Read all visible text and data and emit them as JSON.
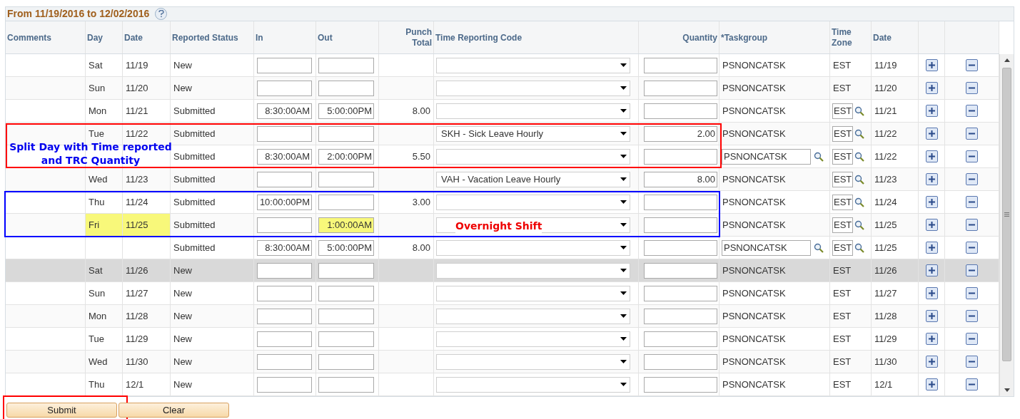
{
  "title": "From 11/19/2016 to 12/02/2016",
  "columns": [
    "Comments",
    "Day",
    "Date",
    "Reported Status",
    "In",
    "Out",
    "Punch Total",
    "Time Reporting Code",
    "Quantity",
    "*Taskgroup",
    "Time Zone",
    "Date"
  ],
  "rows": [
    {
      "day": "Sat",
      "date": "11/19",
      "status": "New",
      "in": "",
      "out": "",
      "punch_total": "",
      "trc": "",
      "quantity": "",
      "taskgroup": "PSNONCATSK",
      "taskgroup_editable": false,
      "timezone": "EST",
      "timezone_editable": false,
      "date2": "11/19",
      "day_highlighted": false,
      "out_highlighted": false,
      "selected": false
    },
    {
      "day": "Sun",
      "date": "11/20",
      "status": "New",
      "in": "",
      "out": "",
      "punch_total": "",
      "trc": "",
      "quantity": "",
      "taskgroup": "PSNONCATSK",
      "taskgroup_editable": false,
      "timezone": "EST",
      "timezone_editable": false,
      "date2": "11/20",
      "day_highlighted": false,
      "out_highlighted": false,
      "selected": false
    },
    {
      "day": "Mon",
      "date": "11/21",
      "status": "Submitted",
      "in": "8:30:00AM",
      "out": "5:00:00PM",
      "punch_total": "8.00",
      "trc": "",
      "quantity": "",
      "taskgroup": "PSNONCATSK",
      "taskgroup_editable": false,
      "timezone": "EST",
      "timezone_editable": true,
      "date2": "11/21",
      "day_highlighted": false,
      "out_highlighted": false,
      "selected": false
    },
    {
      "day": "Tue",
      "date": "11/22",
      "status": "Submitted",
      "in": "",
      "out": "",
      "punch_total": "",
      "trc": "SKH - Sick Leave Hourly",
      "quantity": "2.00",
      "taskgroup": "PSNONCATSK",
      "taskgroup_editable": false,
      "timezone": "EST",
      "timezone_editable": true,
      "date2": "11/22",
      "day_highlighted": false,
      "out_highlighted": false,
      "selected": false
    },
    {
      "day": "",
      "date": "",
      "status": "Submitted",
      "in": "8:30:00AM",
      "out": "2:00:00PM",
      "punch_total": "5.50",
      "trc": "",
      "quantity": "",
      "taskgroup": "PSNONCATSK",
      "taskgroup_editable": true,
      "timezone": "EST",
      "timezone_editable": true,
      "date2": "11/22",
      "day_highlighted": false,
      "out_highlighted": false,
      "selected": false
    },
    {
      "day": "Wed",
      "date": "11/23",
      "status": "Submitted",
      "in": "",
      "out": "",
      "punch_total": "",
      "trc": "VAH - Vacation Leave Hourly",
      "quantity": "8.00",
      "taskgroup": "PSNONCATSK",
      "taskgroup_editable": false,
      "timezone": "EST",
      "timezone_editable": true,
      "date2": "11/23",
      "day_highlighted": false,
      "out_highlighted": false,
      "selected": false
    },
    {
      "day": "Thu",
      "date": "11/24",
      "status": "Submitted",
      "in": "10:00:00PM",
      "out": "",
      "punch_total": "3.00",
      "trc": "",
      "quantity": "",
      "taskgroup": "PSNONCATSK",
      "taskgroup_editable": false,
      "timezone": "EST",
      "timezone_editable": true,
      "date2": "11/24",
      "day_highlighted": false,
      "out_highlighted": false,
      "selected": false
    },
    {
      "day": "Fri",
      "date": "11/25",
      "status": "Submitted",
      "in": "",
      "out": "1:00:00AM",
      "punch_total": "",
      "trc": "",
      "quantity": "",
      "taskgroup": "PSNONCATSK",
      "taskgroup_editable": false,
      "timezone": "EST",
      "timezone_editable": true,
      "date2": "11/25",
      "day_highlighted": true,
      "out_highlighted": true,
      "selected": false
    },
    {
      "day": "",
      "date": "",
      "status": "Submitted",
      "in": "8:30:00AM",
      "out": "5:00:00PM",
      "punch_total": "8.00",
      "trc": "",
      "quantity": "",
      "taskgroup": "PSNONCATSK",
      "taskgroup_editable": true,
      "timezone": "EST",
      "timezone_editable": true,
      "date2": "11/25",
      "day_highlighted": false,
      "out_highlighted": false,
      "selected": false
    },
    {
      "day": "Sat",
      "date": "11/26",
      "status": "New",
      "in": "",
      "out": "",
      "punch_total": "",
      "trc": "",
      "quantity": "",
      "taskgroup": "PSNONCATSK",
      "taskgroup_editable": false,
      "timezone": "EST",
      "timezone_editable": false,
      "date2": "11/26",
      "day_highlighted": false,
      "out_highlighted": false,
      "selected": true
    },
    {
      "day": "Sun",
      "date": "11/27",
      "status": "New",
      "in": "",
      "out": "",
      "punch_total": "",
      "trc": "",
      "quantity": "",
      "taskgroup": "PSNONCATSK",
      "taskgroup_editable": false,
      "timezone": "EST",
      "timezone_editable": false,
      "date2": "11/27",
      "day_highlighted": false,
      "out_highlighted": false,
      "selected": false
    },
    {
      "day": "Mon",
      "date": "11/28",
      "status": "New",
      "in": "",
      "out": "",
      "punch_total": "",
      "trc": "",
      "quantity": "",
      "taskgroup": "PSNONCATSK",
      "taskgroup_editable": false,
      "timezone": "EST",
      "timezone_editable": false,
      "date2": "11/28",
      "day_highlighted": false,
      "out_highlighted": false,
      "selected": false
    },
    {
      "day": "Tue",
      "date": "11/29",
      "status": "New",
      "in": "",
      "out": "",
      "punch_total": "",
      "trc": "",
      "quantity": "",
      "taskgroup": "PSNONCATSK",
      "taskgroup_editable": false,
      "timezone": "EST",
      "timezone_editable": false,
      "date2": "11/29",
      "day_highlighted": false,
      "out_highlighted": false,
      "selected": false
    },
    {
      "day": "Wed",
      "date": "11/30",
      "status": "New",
      "in": "",
      "out": "",
      "punch_total": "",
      "trc": "",
      "quantity": "",
      "taskgroup": "PSNONCATSK",
      "taskgroup_editable": false,
      "timezone": "EST",
      "timezone_editable": false,
      "date2": "11/30",
      "day_highlighted": false,
      "out_highlighted": false,
      "selected": false
    },
    {
      "day": "Thu",
      "date": "12/1",
      "status": "New",
      "in": "",
      "out": "",
      "punch_total": "",
      "trc": "",
      "quantity": "",
      "taskgroup": "PSNONCATSK",
      "taskgroup_editable": false,
      "timezone": "EST",
      "timezone_editable": false,
      "date2": "12/1",
      "day_highlighted": false,
      "out_highlighted": false,
      "selected": false
    }
  ],
  "annotations": [
    {
      "kind": "split_note",
      "text": "Split Day with Time reported and TRC Quantity",
      "color": "#ff0000"
    },
    {
      "kind": "overnight_note",
      "text": "Overnight Shift",
      "color": "#0000ff"
    },
    {
      "kind": "submit_box",
      "color": "#ff0000"
    }
  ],
  "buttons": [
    "Submit",
    "Clear"
  ]
}
